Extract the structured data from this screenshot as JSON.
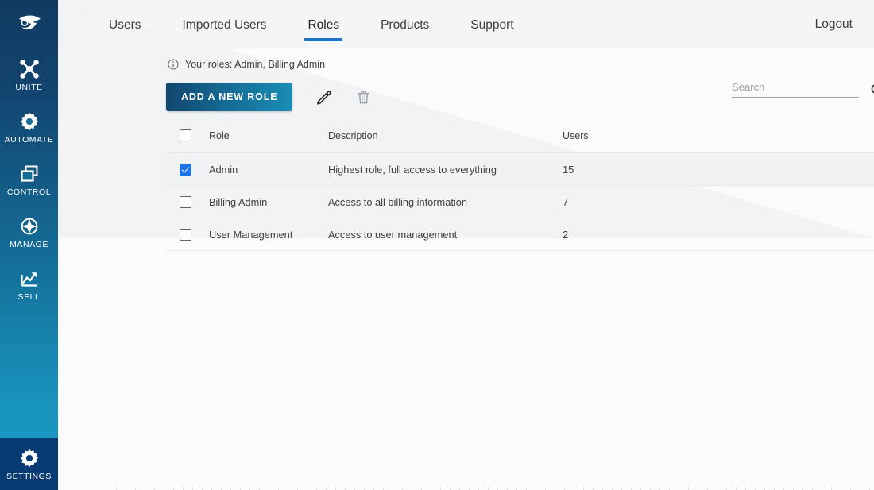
{
  "sidebar": {
    "logo_icon": "brand-bird-logo",
    "items": [
      {
        "label": "UNITE",
        "icon": "network-nodes-icon"
      },
      {
        "label": "AUTOMATE",
        "icon": "gear-icon"
      },
      {
        "label": "CONTROL",
        "icon": "windows-stack-icon"
      },
      {
        "label": "MANAGE",
        "icon": "compass-icon"
      },
      {
        "label": "SELL",
        "icon": "chart-arrow-up-icon"
      }
    ],
    "settings": {
      "label": "SETTINGS",
      "icon": "gear-icon"
    },
    "gradient_top": "#113a61",
    "gradient_bottom": "#1c9cc6",
    "settings_bg": "#073b73"
  },
  "topbar": {
    "tabs": [
      {
        "label": "Users",
        "active": false
      },
      {
        "label": "Imported Users",
        "active": false
      },
      {
        "label": "Roles",
        "active": true
      },
      {
        "label": "Products",
        "active": false
      },
      {
        "label": "Support",
        "active": false
      }
    ],
    "logout_label": "Logout",
    "active_underline_color": "#1a73c8"
  },
  "notice": {
    "icon": "info-circle-icon",
    "text": "Your roles: Admin, Billing Admin"
  },
  "toolbar": {
    "add_role_label": "ADD A NEW ROLE",
    "edit_icon": "pencil-icon",
    "delete_icon": "trash-icon",
    "button_gradient_start": "#11466e",
    "button_gradient_end": "#1a8db5"
  },
  "search": {
    "placeholder": "Search",
    "value": "",
    "icon": "search-icon"
  },
  "table": {
    "columns": [
      "Role",
      "Description",
      "Users"
    ],
    "select_all_checked": false,
    "rows": [
      {
        "selected": true,
        "role": "Admin",
        "description": "Highest role, full access to everything",
        "users": "15"
      },
      {
        "selected": false,
        "role": "Billing Admin",
        "description": "Access to all billing information",
        "users": "7"
      },
      {
        "selected": false,
        "role": "User Management",
        "description": "Access to user management",
        "users": "2"
      }
    ]
  }
}
